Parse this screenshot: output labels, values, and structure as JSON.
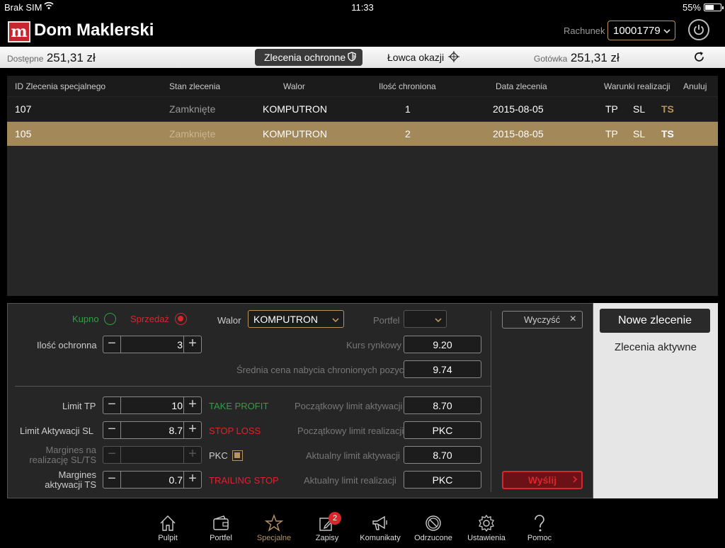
{
  "status": {
    "carrier": "Brak SIM",
    "time": "11:33",
    "battery": "55%"
  },
  "header": {
    "logo_letter": "m",
    "app_title": "Dom Maklerski",
    "account_label": "Rachunek",
    "account_value": "10001779"
  },
  "balance": {
    "available_label": "Dostępne",
    "available_value": "251,31 zł",
    "cash_label": "Gotówka",
    "cash_value": "251,31 zł",
    "tab_protective": "Zlecenia ochronne",
    "tab_hunter": "Łowca okazji"
  },
  "table": {
    "headers": {
      "id": "ID Zlecenia specjalnego",
      "state": "Stan zlecenia",
      "walor": "Walor",
      "qty": "Ilość chroniona",
      "date": "Data zlecenia",
      "conditions": "Warunki realizacji",
      "cancel": "Anuluj"
    },
    "rows": [
      {
        "id": "107",
        "state": "Zamknięte",
        "walor": "KOMPUTRON",
        "qty": "1",
        "date": "2015-08-05",
        "tp": "TP",
        "sl": "SL",
        "ts": "TS"
      },
      {
        "id": "105",
        "state": "Zamknięte",
        "walor": "KOMPUTRON",
        "qty": "2",
        "date": "2015-08-05",
        "tp": "TP",
        "sl": "SL",
        "ts": "TS"
      }
    ]
  },
  "form": {
    "buy_label": "Kupno",
    "sell_label": "Sprzedaż",
    "walor_label": "Walor",
    "walor_value": "KOMPUTRON",
    "portfolio_label": "Portfel",
    "qty_label": "Ilość ochronna",
    "qty_value": "3",
    "market_price_label": "Kurs rynkowy",
    "market_price_value": "9.20",
    "avg_price_label": "Średnia cena nabycia chronionych pozycji",
    "avg_price_value": "9.74",
    "limit_tp_label": "Limit TP",
    "limit_tp_value": "10",
    "take_profit": "TAKE PROFIT",
    "limit_sl_label": "Limit Aktywacji SL",
    "limit_sl_value": "8.7",
    "stop_loss": "STOP LOSS",
    "margin_sl_label_1": "Margines na",
    "margin_sl_label_2": "realizację SL/TS",
    "pkc_label": "PKC",
    "margin_ts_label_1": "Margines",
    "margin_ts_label_2": "aktywacji TS",
    "margin_ts_value": "0.7",
    "trailing_stop": "TRAILING STOP",
    "init_act_label": "Początkowy limit aktywacji",
    "init_act_value": "8.70",
    "init_real_label": "Początkowy limit realizacji",
    "init_real_value": "PKC",
    "cur_act_label": "Aktualny limit aktywacji",
    "cur_act_value": "8.70",
    "cur_real_label": "Aktualny limit realizacji",
    "cur_real_value": "PKC",
    "clear_button": "Wyczyść",
    "send_button": "Wyślij"
  },
  "side": {
    "new_order": "Nowe zlecenie",
    "active_orders": "Zlecenia aktywne"
  },
  "tabbar": {
    "items": [
      {
        "label": "Pulpit",
        "icon": "home-icon"
      },
      {
        "label": "Portfel",
        "icon": "wallet-icon"
      },
      {
        "label": "Specjalne",
        "icon": "star-icon"
      },
      {
        "label": "Zapisy",
        "icon": "edit-icon",
        "badge": "2"
      },
      {
        "label": "Komunikaty",
        "icon": "megaphone-icon"
      },
      {
        "label": "Odrzucone",
        "icon": "rejected-icon"
      },
      {
        "label": "Ustawienia",
        "icon": "gear-icon"
      },
      {
        "label": "Pomoc",
        "icon": "help-icon"
      }
    ],
    "active_index": 2
  },
  "colors": {
    "accent_gold": "#b89460",
    "danger_red": "#d8262c",
    "success_green": "#2ea043",
    "selected_row": "#a3885a"
  }
}
